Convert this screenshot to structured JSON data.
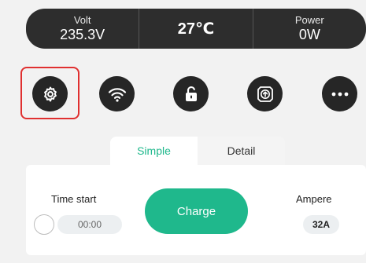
{
  "status": {
    "volt_label": "Volt",
    "volt_value": "235.3V",
    "temperature": "27℃",
    "power_label": "Power",
    "power_value": "0W"
  },
  "actions": [
    {
      "icon": "gear-icon",
      "highlighted": true
    },
    {
      "icon": "wifi-icon"
    },
    {
      "icon": "unlock-icon"
    },
    {
      "icon": "upgrade-icon"
    },
    {
      "icon": "more-icon"
    }
  ],
  "tabs": {
    "simple": "Simple",
    "detail": "Detail",
    "active": "simple"
  },
  "panel": {
    "time_label": "Time start",
    "time_value": "00:00",
    "charge_label": "Charge",
    "ampere_label": "Ampere",
    "ampere_value": "32A"
  },
  "colors": {
    "accent": "#1fb88c",
    "dark": "#262626",
    "highlight": "#e03030"
  }
}
